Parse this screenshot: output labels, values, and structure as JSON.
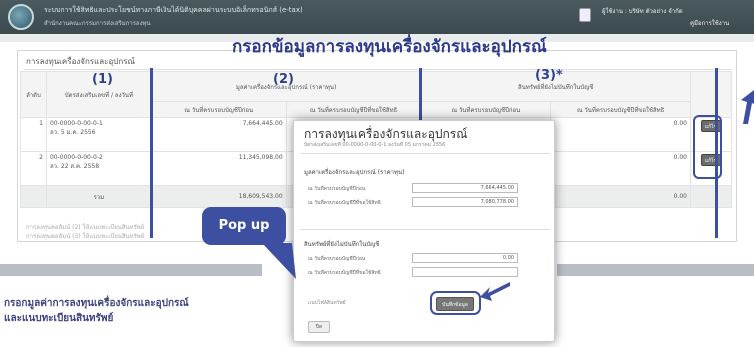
{
  "header": {
    "system_title": "ระบบการใช้สิทธิและประโยชน์ทางภาษีเงินได้นิติบุคคลผ่านระบบอิเล็กทรอนิกส์ (e-tax)",
    "agency": "สำนักงานคณะกรรมการส่งเสริมการลงทุน",
    "user_text": "ผู้ใช้งาน : บริษัท ตัวอย่าง จำกัด",
    "user_link": "คู่มือการใช้งาน"
  },
  "annotation": {
    "main_title": "กรอกข้อมูลการลงทุนเครื่องจักรและอุปกรณ์",
    "col1": "(1)",
    "col2": "(2)",
    "col3": "(3)*",
    "popup_tag": "Pop up",
    "caption_line1": "กรอกมูลค่าการลงทุนเครื่องจักรและอุปกรณ์",
    "caption_line2": "และแนบทะเบียนสินทรัพย์"
  },
  "section": {
    "title": "การลงทุนเครื่องจักรและอุปกรณ์"
  },
  "table": {
    "h_no": "ลำดับ",
    "h_cert": "บัตรส่งเสริมเลขที่ / ลงวันที่",
    "h_value": "มูลค่าเครื่องจักรและอุปกรณ์ (ราคาทุน)",
    "h_asset": "สินทรัพย์ที่ยังไม่บันทึกในบัญชี",
    "h_sub1": "ณ วันที่ครบรอบบัญชีปีก่อน",
    "h_sub2": "ณ วันที่ครบรอบบัญชีปีที่ขอใช้สิทธิ",
    "h_sub3": "ณ วันที่ครบรอบบัญชีปีก่อน",
    "h_sub4": "ณ วันที่ครบรอบบัญชีปีที่ขอใช้สิทธิ",
    "rows": [
      {
        "no": "1",
        "cert": "00-0000-0-00-0-1",
        "date": "ลว. 5 ม.ค. 2556",
        "v1": "7,664,445.00",
        "v2": "",
        "v3": "",
        "v4": "0.00",
        "edit": "แก้ไข"
      },
      {
        "no": "2",
        "cert": "00-0000-0-00-0-2",
        "date": "ลว. 22 ส.ค. 2558",
        "v1": "11,345,098.00",
        "v2": "",
        "v3": "",
        "v4": "0.00",
        "edit": "แก้ไข"
      }
    ],
    "sum_label": "รวม",
    "sum_v1": "18,609,543.00",
    "sum_v4": "0.00",
    "note1": "การลงทุนคอลัมน์ (2) ให้แนบทะเบียนสินทรัพย์",
    "note2": "การลงทุนคอลัมน์ (3) ให้แนบทะเบียนสินทรัพย์"
  },
  "popup": {
    "title": "การลงทุนเครื่องจักรและอุปกรณ์",
    "subtitle": "บัตรส่งเสริมเลขที่ 00-0000-0-00-0-1 ลงวันที่ 05 มกราคม 2556",
    "sec1": "มูลค่าเครื่องจักรและอุปกรณ์ (ราคาทุน)",
    "label1": "ณ วันที่ครบรอบบัญชีปีก่อน",
    "input1": "7,664,445.00",
    "label2": "ณ วันที่ครบรอบบัญชีปีที่ขอใช้สิทธิ",
    "input2": "7,080,778.00",
    "sec2": "สินทรัพย์ที่ยังไม่บันทึกในบัญชี",
    "label3": "ณ วันที่ครบรอบบัญชีปีก่อน",
    "input3": "0.00",
    "label4": "ณ วันที่ครบรอบบัญชีปีที่ขอใช้สิทธิ",
    "input4": "",
    "attach": "แนบไฟล์สินทรัพย์",
    "save": "บันทึกข้อมูล",
    "close": "ปิด"
  }
}
